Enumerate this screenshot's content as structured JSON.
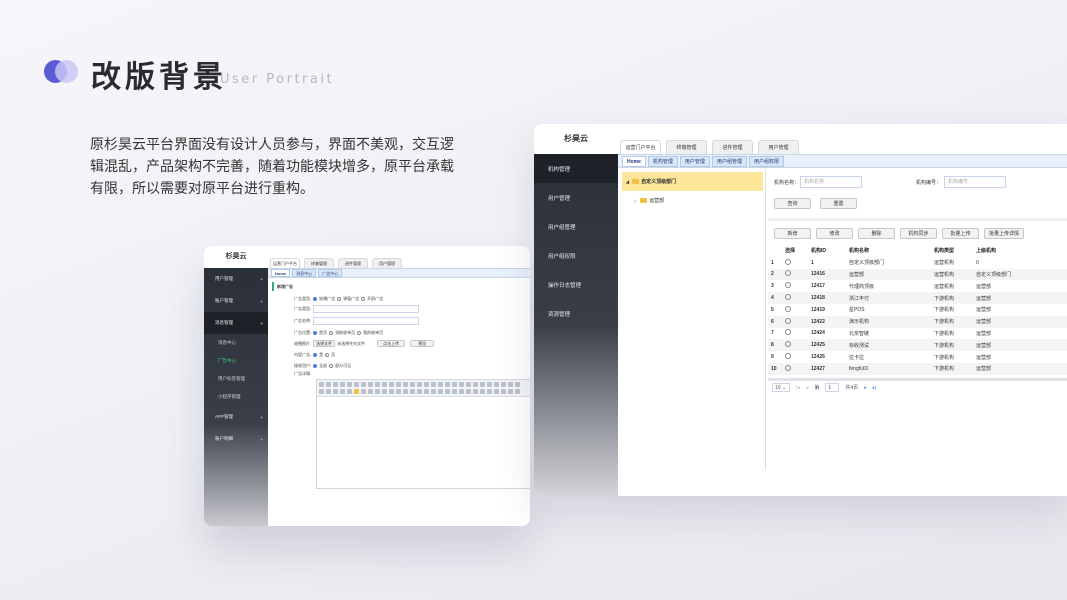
{
  "header": {
    "title": "改版背景",
    "subtitle": "User Portrait"
  },
  "description": "原杉昊云平台界面没有设计人员参与，界面不美观，交互逻辑混乱，产品架构不完善，随着功能模块增多，原平台承载有限，所以需要对原平台进行重构。",
  "shotA": {
    "brand": "杉昊云",
    "top_tabs": [
      "运营门户平台",
      "终端管理",
      "进件管理",
      "用户管理"
    ],
    "sidebar": [
      {
        "label": "用户管理",
        "mark": "+"
      },
      {
        "label": "账户管理",
        "mark": "+"
      },
      {
        "label": "消息管理",
        "mark": "×"
      },
      {
        "label": "消息中心",
        "mark": ""
      },
      {
        "label": "广告中心",
        "mark": ""
      },
      {
        "label": "用户标签管理",
        "mark": ""
      },
      {
        "label": "小程序管理",
        "mark": ""
      },
      {
        "label": "APP管理",
        "mark": "+"
      },
      {
        "label": "账户明细",
        "mark": "+"
      }
    ],
    "breadcrumb_tabs": [
      "Home",
      "消息中心",
      "广告中心"
    ],
    "section_title": "新增广告",
    "form": {
      "ad_type_label": "广告类型:",
      "ad_type_options": [
        "轮播广告",
        "弹窗广告",
        "开屏广告"
      ],
      "ad_category_label": "广告类型:",
      "ad_name_label": "广告名称:",
      "ad_position_label": "广告位置:",
      "ad_position_options": [
        "首页",
        "领取收单页",
        "我的收单页"
      ],
      "ad_image_label": "轮播图片:",
      "choose_file": "选择文件",
      "no_file": "未选择任何文件",
      "upload": "点击上传",
      "preview": "预览",
      "content_label": "内容广告:",
      "content_options": [
        "是",
        "否"
      ],
      "audience_label": "接收用户:",
      "audience_options": [
        "全部",
        "部分可见"
      ],
      "detail_label": "广告详情:"
    }
  },
  "shotB": {
    "brand": "杉昊云",
    "top_tabs": [
      "运营门户平台",
      "终端管理",
      "进件管理",
      "用户管理"
    ],
    "sidebar": [
      "机构管理",
      "用户管理",
      "用户组管理",
      "用户组权限",
      "操作日志管理",
      "资源管理"
    ],
    "breadcrumb_tabs": [
      "Home",
      "机构管理",
      "用户管理",
      "用户组管理",
      "用户组权限"
    ],
    "tree": {
      "root": "自定义顶级部门",
      "child": "运营部"
    },
    "search": {
      "name_label": "机构名称：",
      "name_placeholder": "机构名称",
      "code_label": "机构编号：",
      "code_placeholder": "机构编号",
      "query": "查询",
      "reset": "重置"
    },
    "actions": [
      "新增",
      "修改",
      "删除",
      "机构同步",
      "批量上传",
      "批量上传详情"
    ],
    "table": {
      "headers": [
        "",
        "选择",
        "机构ID",
        "机构名称",
        "机构类型",
        "上级机构"
      ],
      "rows": [
        [
          "1",
          "",
          "1",
          "自定义顶级部门",
          "运营机构",
          "0"
        ],
        [
          "2",
          "",
          "12416",
          "运营部",
          "运营机构",
          "自定义顶级部门"
        ],
        [
          "3",
          "",
          "12417",
          "代理商顶级",
          "运营机构",
          "运营部"
        ],
        [
          "4",
          "",
          "12418",
          "浙江丰付",
          "下游机构",
          "运营部"
        ],
        [
          "5",
          "",
          "12419",
          "星POS",
          "下游机构",
          "运营部"
        ],
        [
          "6",
          "",
          "12422",
          "演示机构",
          "下游机构",
          "运营部"
        ],
        [
          "7",
          "",
          "12424",
          "北京智链",
          "下游机构",
          "运营部"
        ],
        [
          "8",
          "",
          "12425",
          "标收测试",
          "下游机构",
          "运营部"
        ],
        [
          "9",
          "",
          "12426",
          "拉卡拉",
          "下游机构",
          "运营部"
        ],
        [
          "10",
          "",
          "12427",
          "fengfu01",
          "下游机构",
          "运营部"
        ]
      ]
    },
    "pagination": {
      "page_size": "10",
      "page": "1",
      "total_pages": "共4页"
    }
  }
}
